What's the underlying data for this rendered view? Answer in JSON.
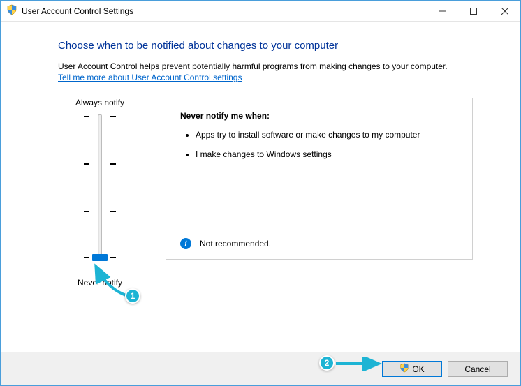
{
  "window": {
    "title": "User Account Control Settings"
  },
  "main": {
    "heading": "Choose when to be notified about changes to your computer",
    "description": "User Account Control helps prevent potentially harmful programs from making changes to your computer.",
    "link": "Tell me more about User Account Control settings"
  },
  "slider": {
    "top_label": "Always notify",
    "bottom_label": "Never notify"
  },
  "infobox": {
    "title": "Never notify me when:",
    "bullets": [
      "Apps try to install software or make changes to my computer",
      "I make changes to Windows settings"
    ],
    "footer": "Not recommended."
  },
  "footer": {
    "ok": "OK",
    "cancel": "Cancel"
  },
  "annotations": {
    "one": "1",
    "two": "2"
  }
}
